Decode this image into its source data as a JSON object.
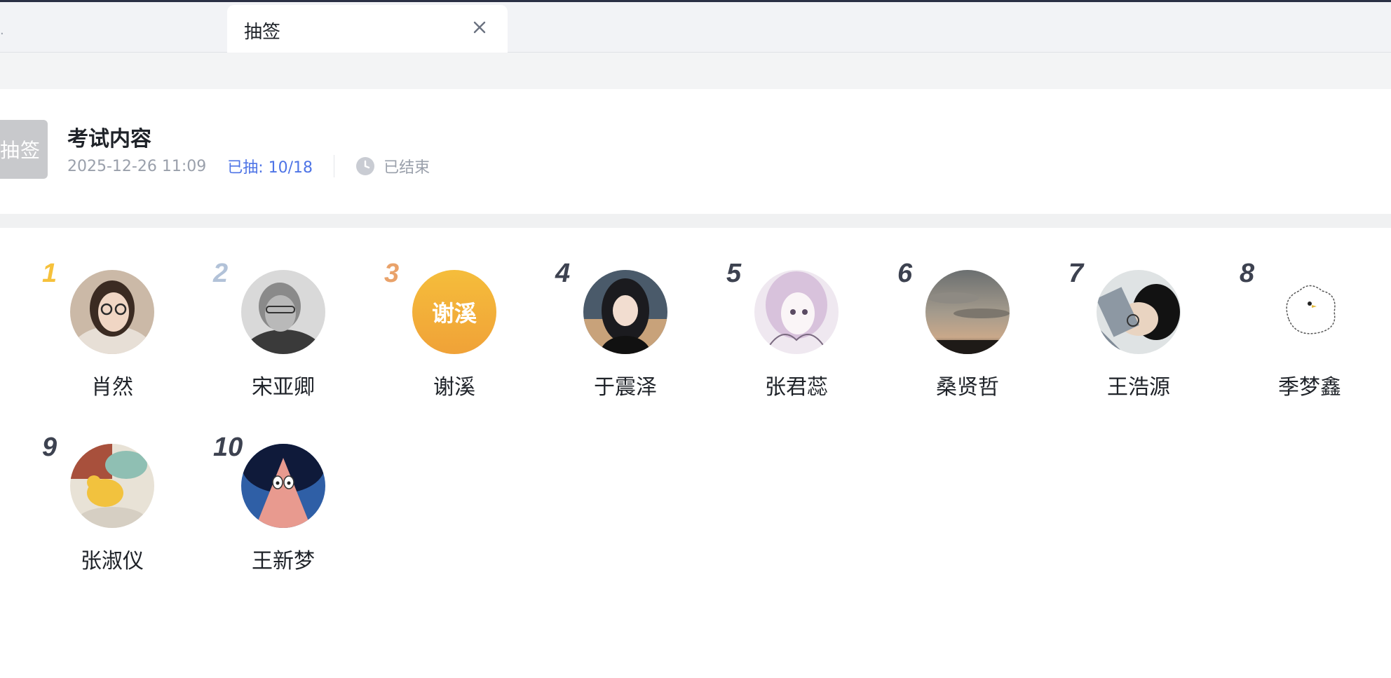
{
  "tab": {
    "label": "抽签",
    "close_icon": "close-icon"
  },
  "header": {
    "badge_text": "抽签",
    "title": "考试内容",
    "datetime": "2025-12-26 11:09",
    "drawn_label": "已抽: 10/18",
    "status_icon": "clock-icon",
    "status": "已结束"
  },
  "colors": {
    "rank1": "#f6c13b",
    "rank2": "#b2c2d8",
    "rank3": "#e9a26a",
    "rank_default": "#3d4250",
    "accent_blue": "#4e74e6"
  },
  "people": [
    {
      "rank": "1",
      "name": "肖然"
    },
    {
      "rank": "2",
      "name": "宋亚卿"
    },
    {
      "rank": "3",
      "name": "谢溪",
      "avatar_text": "谢溪"
    },
    {
      "rank": "4",
      "name": "于震泽"
    },
    {
      "rank": "5",
      "name": "张君蕊"
    },
    {
      "rank": "6",
      "name": "桑贤哲"
    },
    {
      "rank": "7",
      "name": "王浩源"
    },
    {
      "rank": "8",
      "name": "季梦鑫"
    },
    {
      "rank": "9",
      "name": "张淑仪"
    },
    {
      "rank": "10",
      "name": "王新梦"
    }
  ]
}
